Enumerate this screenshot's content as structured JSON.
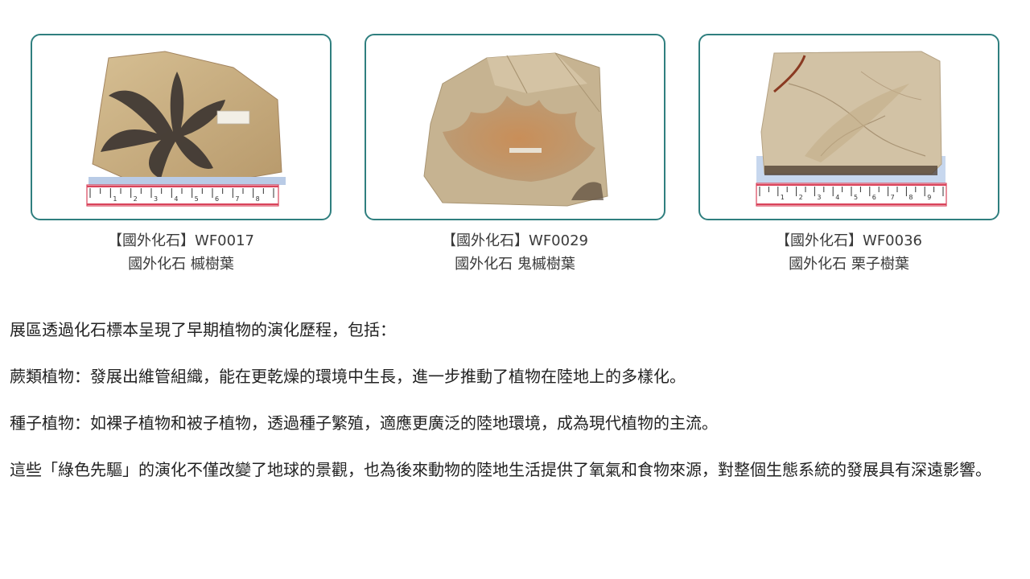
{
  "fossils": [
    {
      "code_line": "【國外化石】WF0017",
      "name_line": "國外化石 槭樹葉",
      "image_icon": "maple-leaf-fossil-photo",
      "ruler_numbers": [
        "1",
        "2",
        "3",
        "4",
        "5",
        "6",
        "7",
        "8"
      ]
    },
    {
      "code_line": "【國外化石】WF0029",
      "name_line": "國外化石 鬼槭樹葉",
      "image_icon": "ghost-maple-leaf-fossil-photo"
    },
    {
      "code_line": "【國外化石】WF0036",
      "name_line": "國外化石 栗子樹葉",
      "image_icon": "chestnut-leaf-fossil-photo",
      "ruler_numbers": [
        "1",
        "2",
        "3",
        "4",
        "5",
        "6",
        "7",
        "8",
        "9"
      ]
    }
  ],
  "paragraphs": {
    "intro": "展區透過化石標本呈現了早期植物的演化歷程，包括：",
    "ferns": "蕨類植物：發展出維管組織，能在更乾燥的環境中生長，進一步推動了植物在陸地上的多樣化。",
    "seeds": "種子植物：如裸子植物和被子植物，透過種子繁殖，適應更廣泛的陸地環境，成為現代植物的主流。",
    "conclusion": "這些「綠色先驅」的演化不僅改變了地球的景觀，也為後來動物的陸地生活提供了氧氣和食物來源，對整個生態系統的發展具有深遠影響。"
  },
  "colors": {
    "card_border": "#2f7f7f",
    "ruler_red": "#d9435b",
    "stone": "#c9b28c"
  }
}
